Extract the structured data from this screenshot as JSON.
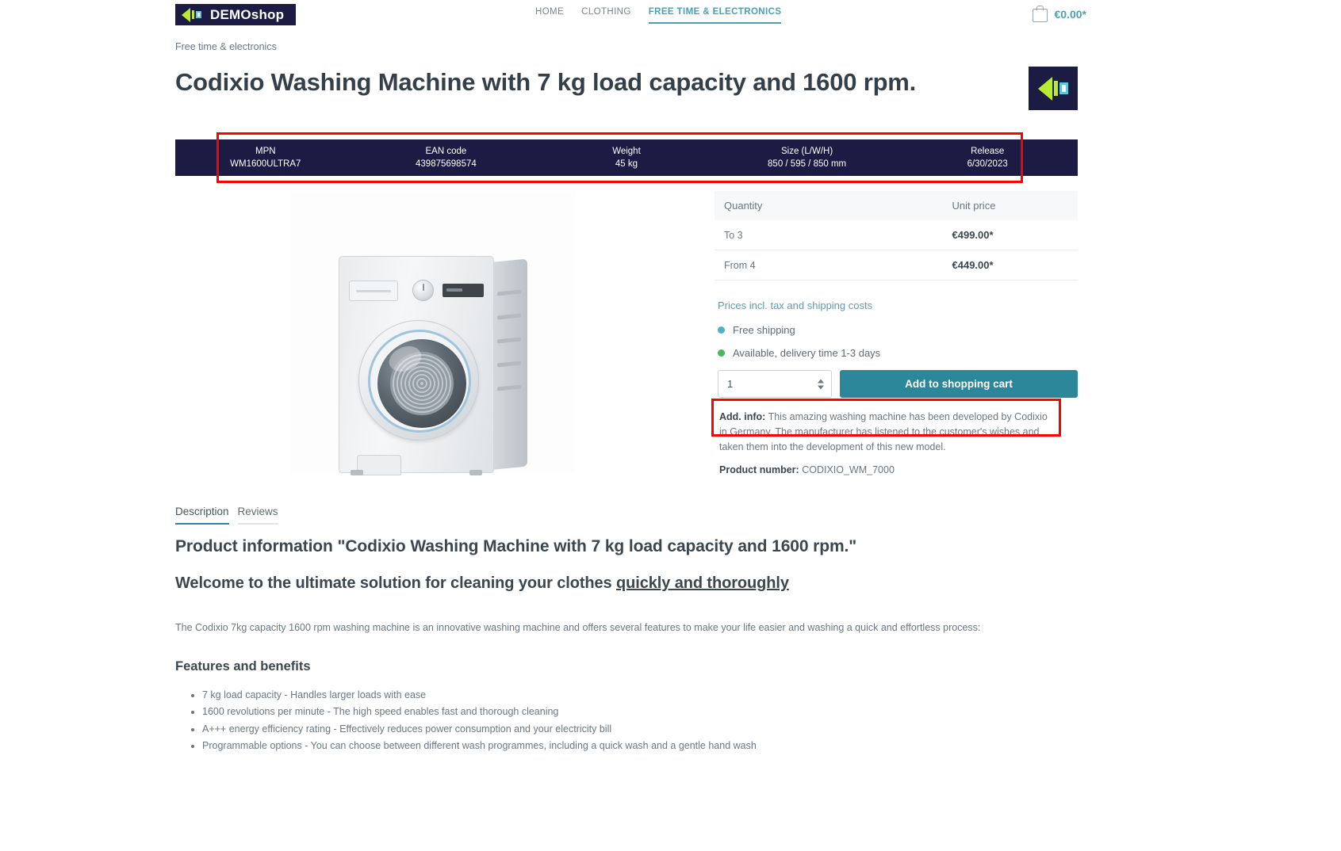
{
  "header": {
    "logo_text": "DEMOshop",
    "nav": [
      {
        "label": "HOME",
        "active": false
      },
      {
        "label": "CLOTHING",
        "active": false
      },
      {
        "label": "FREE TIME & ELECTRONICS",
        "active": true
      }
    ],
    "cart_amount": "€0.00*"
  },
  "breadcrumb": "Free time & electronics",
  "product": {
    "title": "Codixio Washing Machine with 7 kg load capacity and 1600 rpm.",
    "number_label": "Product number:",
    "number_value": "CODIXIO_WM_7000"
  },
  "specs": [
    {
      "label": "MPN",
      "value": "WM1600ULTRA7"
    },
    {
      "label": "EAN code",
      "value": "439875698574"
    },
    {
      "label": "Weight",
      "value": "45 kg"
    },
    {
      "label": "Size (L/W/H)",
      "value": "850 / 595 / 850 mm"
    },
    {
      "label": "Release",
      "value": "6/30/2023"
    }
  ],
  "pricing": {
    "col_quantity": "Quantity",
    "col_unit_price": "Unit price",
    "rows": [
      {
        "quantity": "To 3",
        "price": "€499.00*"
      },
      {
        "quantity": "From 4",
        "price": "€449.00*"
      }
    ],
    "tax_note": "Prices incl. tax and shipping costs"
  },
  "availability": [
    {
      "text": "Free shipping",
      "color": "#4db2c9"
    },
    {
      "text": "Available, delivery time 1-3 days",
      "color": "#45b95b"
    }
  ],
  "buy": {
    "quantity_value": "1",
    "add_to_cart_label": "Add to shopping cart"
  },
  "additional_info": {
    "label": "Add. info:",
    "text": " This amazing washing machine has been developed by Codixio in Germany. The manufacturer has listened to the customer's wishes and taken them into the development of this new model."
  },
  "tabs": [
    {
      "label": "Description",
      "active": true
    },
    {
      "label": "Reviews",
      "active": false
    }
  ],
  "description": {
    "heading": "Product information \"Codixio Washing Machine with 7 kg load capacity and 1600 rpm.\"",
    "subheading_plain": "Welcome to the ultimate solution for cleaning your clothes ",
    "subheading_underlined": "quickly and thoroughly",
    "intro": "The Codixio 7kg capacity 1600 rpm washing machine is an innovative washing machine and offers several features to make your life easier and washing a quick and effortless process:",
    "features_heading": "Features and benefits",
    "features": [
      "7 kg load capacity - Handles larger loads with ease",
      "1600 revolutions per minute - The high speed enables fast and thorough cleaning",
      "A+++ energy efficiency rating - Effectively reduces power consumption and your electricity bill",
      "Programmable options - You can choose between different wash programmes, including a quick wash and a gentle hand wash"
    ]
  },
  "theme": {
    "accent": "#2b8799",
    "navy": "#1b1b44",
    "highlight": "#ff0000"
  }
}
